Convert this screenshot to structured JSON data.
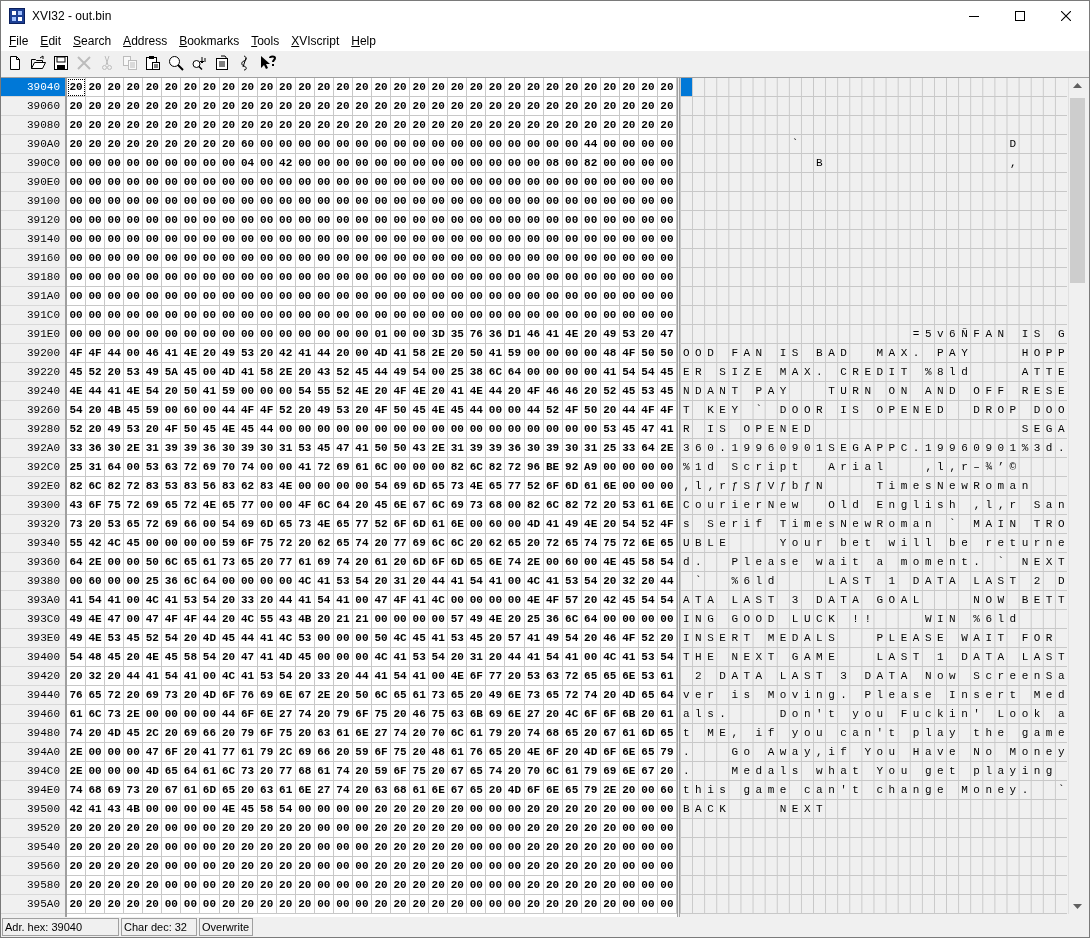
{
  "window": {
    "title": "XVI32 - out.bin"
  },
  "menu": [
    "File",
    "Edit",
    "Search",
    "Address",
    "Bookmarks",
    "Tools",
    "XVIscript",
    "Help"
  ],
  "toolbar": [
    {
      "kind": "new",
      "disabled": false
    },
    {
      "kind": "open",
      "disabled": false
    },
    {
      "kind": "save",
      "disabled": false
    },
    {
      "kind": "delete",
      "disabled": true
    },
    {
      "kind": "cut",
      "disabled": true
    },
    {
      "kind": "copy",
      "disabled": true
    },
    {
      "kind": "paste",
      "disabled": false
    },
    {
      "kind": "find",
      "disabled": false
    },
    {
      "kind": "replace",
      "disabled": false
    },
    {
      "kind": "properties",
      "disabled": false
    },
    {
      "kind": "link",
      "disabled": false
    },
    {
      "kind": "help",
      "disabled": false
    }
  ],
  "rows": [
    {
      "address": "39040",
      "selected": true,
      "bytes": "20 20 20 20 20 20 20 20 20 20 20 20 20 20 20 20 20 20 20 20 20 20 20 20 20 20 20 20 20 20 20 20"
    },
    {
      "address": "39060",
      "selected": false,
      "bytes": "20 20 20 20 20 20 20 20 20 20 20 20 20 20 20 20 20 20 20 20 20 20 20 20 20 20 20 20 20 20 20 20"
    },
    {
      "address": "39080",
      "selected": false,
      "bytes": "20 20 20 20 20 20 20 20 20 20 20 20 20 20 20 20 20 20 20 20 20 20 20 20 20 20 20 20 20 20 20 20"
    },
    {
      "address": "390A0",
      "selected": false,
      "bytes": "20 20 20 20 20 20 20 20 20 60 00 00 00 00 00 00 00 00 00 00 00 00 00 00 00 00 00 44 00 00 00 00",
      "text": "         `                 D    "
    },
    {
      "address": "390C0",
      "selected": false,
      "bytes": "00 00 00 00 00 00 00 00 00 04 00 42 00 00 00 00 00 00 00 00 00 00 00 00 00 08 00 82 00 00 00 00",
      "text": "           B               ‚    "
    },
    {
      "address": "390E0",
      "selected": false,
      "bytes": "00 00 00 00 00 00 00 00 00 00 00 00 00 00 00 00 00 00 00 00 00 00 00 00 00 00 00 00 00 00 00 00"
    },
    {
      "address": "39100",
      "selected": false,
      "bytes": "00 00 00 00 00 00 00 00 00 00 00 00 00 00 00 00 00 00 00 00 00 00 00 00 00 00 00 00 00 00 00 00"
    },
    {
      "address": "39120",
      "selected": false,
      "bytes": "00 00 00 00 00 00 00 00 00 00 00 00 00 00 00 00 00 00 00 00 00 00 00 00 00 00 00 00 00 00 00 00"
    },
    {
      "address": "39140",
      "selected": false,
      "bytes": "00 00 00 00 00 00 00 00 00 00 00 00 00 00 00 00 00 00 00 00 00 00 00 00 00 00 00 00 00 00 00 00"
    },
    {
      "address": "39160",
      "selected": false,
      "bytes": "00 00 00 00 00 00 00 00 00 00 00 00 00 00 00 00 00 00 00 00 00 00 00 00 00 00 00 00 00 00 00 00"
    },
    {
      "address": "39180",
      "selected": false,
      "bytes": "00 00 00 00 00 00 00 00 00 00 00 00 00 00 00 00 00 00 00 00 00 00 00 00 00 00 00 00 00 00 00 00"
    },
    {
      "address": "391A0",
      "selected": false,
      "bytes": "00 00 00 00 00 00 00 00 00 00 00 00 00 00 00 00 00 00 00 00 00 00 00 00 00 00 00 00 00 00 00 00"
    },
    {
      "address": "391C0",
      "selected": false,
      "bytes": "00 00 00 00 00 00 00 00 00 00 00 00 00 00 00 00 00 00 00 00 00 00 00 00 00 00 00 00 00 00 00 00"
    },
    {
      "address": "391E0",
      "selected": false,
      "bytes": "00 00 00 00 00 00 00 00 00 00 00 00 00 00 00 00 01 00 00 3D 35 76 36 D1 46 41 4E 20 49 53 20 47",
      "text": "                   =5v6ÑFAN IS G"
    },
    {
      "address": "39200",
      "selected": false,
      "bytes": "4F 4F 44 00 46 41 4E 20 49 53 20 42 41 44 20 00 4D 41 58 2E 20 50 41 59 00 00 00 00 48 4F 50 50",
      "text": "OOD FAN IS BAD  MAX. PAY    HOPP"
    },
    {
      "address": "39220",
      "selected": false,
      "bytes": "45 52 20 53 49 5A 45 00 4D 41 58 2E 20 43 52 45 44 49 54 00 25 38 6C 64 00 00 00 00 41 54 54 45",
      "text": "ER SIZE MAX. CREDIT %8ld    ATTE"
    },
    {
      "address": "39240",
      "selected": false,
      "bytes": "4E 44 41 4E 54 20 50 41 59 00 00 00 54 55 52 4E 20 4F 4E 20 41 4E 44 20 4F 46 46 20 52 45 53 45",
      "text": "NDANT PAY   TURN ON AND OFF RESE"
    },
    {
      "address": "39260",
      "selected": false,
      "bytes": "54 20 4B 45 59 00 60 00 44 4F 4F 52 20 49 53 20 4F 50 45 4E 45 44 00 00 44 52 4F 50 20 44 4F 4F",
      "text": "T KEY ` DOOR IS OPENED  DROP DOO"
    },
    {
      "address": "39280",
      "selected": false,
      "bytes": "52 20 49 53 20 4F 50 45 4E 45 44 00 00 00 00 00 00 00 00 00 00 00 00 00 00 00 00 00 53 45 47 41",
      "text": "R IS OPENED                 SEGA"
    },
    {
      "address": "392A0",
      "selected": false,
      "bytes": "33 36 30 2E 31 39 39 36 30 39 30 31 53 45 47 41 50 50 43 2E 31 39 39 36 30 39 30 31 25 33 64 2E",
      "text": "360.19960901SEGAPPC.19960901%3d."
    },
    {
      "address": "392C0",
      "selected": false,
      "bytes": "25 31 64 00 53 63 72 69 70 74 00 00 41 72 69 61 6C 00 00 00 82 6C 82 72 96 BE 92 A9 00 00 00 00",
      "text": "%1d Script  Arial   ‚l‚r–¾’©    "
    },
    {
      "address": "392E0",
      "selected": false,
      "bytes": "82 6C 82 72 83 53 83 56 83 62 83 4E 00 00 00 00 54 69 6D 65 73 4E 65 77 52 6F 6D 61 6E 00 00 00",
      "text": "‚l‚rƒSƒVƒbƒN    TimesNewRoman   "
    },
    {
      "address": "39300",
      "selected": false,
      "bytes": "43 6F 75 72 69 65 72 4E 65 77 00 00 4F 6C 64 20 45 6E 67 6C 69 73 68 00 82 6C 82 72 20 53 61 6E",
      "text": "CourierNew  Old English ‚l‚r San"
    },
    {
      "address": "39320",
      "selected": false,
      "bytes": "73 20 53 65 72 69 66 00 54 69 6D 65 73 4E 65 77 52 6F 6D 61 6E 00 60 00 4D 41 49 4E 20 54 52 4F",
      "text": "s Serif TimesNewRoman ` MAIN TRO"
    },
    {
      "address": "39340",
      "selected": false,
      "bytes": "55 42 4C 45 00 00 00 00 59 6F 75 72 20 62 65 74 20 77 69 6C 6C 20 62 65 20 72 65 74 75 72 6E 65",
      "text": "UBLE    Your bet will be returne"
    },
    {
      "address": "39360",
      "selected": false,
      "bytes": "64 2E 00 00 50 6C 65 61 73 65 20 77 61 69 74 20 61 20 6D 6F 6D 65 6E 74 2E 00 60 00 4E 45 58 54",
      "text": "d.  Please wait a moment. ` NEXT"
    },
    {
      "address": "39380",
      "selected": false,
      "bytes": "00 60 00 00 25 36 6C 64 00 00 00 00 4C 41 53 54 20 31 20 44 41 54 41 00 4C 41 53 54 20 32 20 44",
      "text": " `  %6ld    LAST 1 DATA LAST 2 D"
    },
    {
      "address": "393A0",
      "selected": false,
      "bytes": "41 54 41 00 4C 41 53 54 20 33 20 44 41 54 41 00 47 4F 41 4C 00 00 00 00 4E 4F 57 20 42 45 54 54",
      "text": "ATA LAST 3 DATA GOAL    NOW BETT"
    },
    {
      "address": "393C0",
      "selected": false,
      "bytes": "49 4E 47 00 47 4F 4F 44 20 4C 55 43 4B 20 21 21 00 00 00 00 57 49 4E 20 25 36 6C 64 00 00 00 00",
      "text": "ING GOOD LUCK !!    WIN %6ld    "
    },
    {
      "address": "393E0",
      "selected": false,
      "bytes": "49 4E 53 45 52 54 20 4D 45 44 41 4C 53 00 00 00 50 4C 45 41 53 45 20 57 41 49 54 20 46 4F 52 20",
      "text": "INSERT MEDALS   PLEASE WAIT FOR "
    },
    {
      "address": "39400",
      "selected": false,
      "bytes": "54 48 45 20 4E 45 58 54 20 47 41 4D 45 00 00 00 4C 41 53 54 20 31 20 44 41 54 41 00 4C 41 53 54",
      "text": "THE NEXT GAME   LAST 1 DATA LAST"
    },
    {
      "address": "39420",
      "selected": false,
      "bytes": "20 32 20 44 41 54 41 00 4C 41 53 54 20 33 20 44 41 54 41 00 4E 6F 77 20 53 63 72 65 65 6E 53 61",
      "text": " 2 DATA LAST 3 DATA Now ScreenSa"
    },
    {
      "address": "39440",
      "selected": false,
      "bytes": "76 65 72 20 69 73 20 4D 6F 76 69 6E 67 2E 20 50 6C 65 61 73 65 20 49 6E 73 65 72 74 20 4D 65 64",
      "text": "ver is Moving. Please Insert Med"
    },
    {
      "address": "39460",
      "selected": false,
      "bytes": "61 6C 73 2E 00 00 00 00 44 6F 6E 27 74 20 79 6F 75 20 46 75 63 6B 69 6E 27 20 4C 6F 6F 6B 20 61",
      "text": "als.    Don't you Fuckin' Look a"
    },
    {
      "address": "39480",
      "selected": false,
      "bytes": "74 20 4D 45 2C 20 69 66 20 79 6F 75 20 63 61 6E 27 74 20 70 6C 61 79 20 74 68 65 20 67 61 6D 65",
      "text": "t ME, if you can't play the game"
    },
    {
      "address": "394A0",
      "selected": false,
      "bytes": "2E 00 00 00 47 6F 20 41 77 61 79 2C 69 66 20 59 6F 75 20 48 61 76 65 20 4E 6F 20 4D 6F 6E 65 79",
      "text": ".   Go Away,if You Have No Money"
    },
    {
      "address": "394C0",
      "selected": false,
      "bytes": "2E 00 00 00 4D 65 64 61 6C 73 20 77 68 61 74 20 59 6F 75 20 67 65 74 20 70 6C 61 79 69 6E 67 20",
      "text": ".   Medals what You get playing "
    },
    {
      "address": "394E0",
      "selected": false,
      "bytes": "74 68 69 73 20 67 61 6D 65 20 63 61 6E 27 74 20 63 68 61 6E 67 65 20 4D 6F 6E 65 79 2E 20 00 60",
      "text": "this game can't change Money.  `"
    },
    {
      "address": "39500",
      "selected": false,
      "bytes": "42 41 43 4B 00 00 00 00 4E 45 58 54 00 00 00 00 20 20 20 20 20 00 00 00 20 20 20 20 20 00 00 00",
      "text": "BACK    NEXT                    "
    },
    {
      "address": "39520",
      "selected": false,
      "bytes": "20 20 20 20 20 00 00 00 20 20 20 20 20 00 00 00 20 20 20 20 20 00 00 00 20 20 20 20 20 00 00 00"
    },
    {
      "address": "39540",
      "selected": false,
      "bytes": "20 20 20 20 20 00 00 00 20 20 20 20 20 00 00 00 20 20 20 20 20 00 00 00 20 20 20 20 20 00 00 00"
    },
    {
      "address": "39560",
      "selected": false,
      "bytes": "20 20 20 20 20 00 00 00 20 20 20 20 20 00 00 00 20 20 20 20 20 00 00 00 20 20 20 20 20 00 00 00"
    },
    {
      "address": "39580",
      "selected": false,
      "bytes": "20 20 20 20 20 00 00 00 20 20 20 20 20 00 00 00 20 20 20 20 20 00 00 00 20 20 20 20 20 00 00 00"
    },
    {
      "address": "395A0",
      "selected": false,
      "bytes": "20 20 20 20 20 00 00 00 20 20 20 20 20 00 00 00 20 20 20 20 20 00 00 00 20 20 20 20 20 00 00 00"
    }
  ],
  "status_bar": [
    "Adr. hex: 39040",
    "Char dec: 32",
    "Overwrite"
  ]
}
